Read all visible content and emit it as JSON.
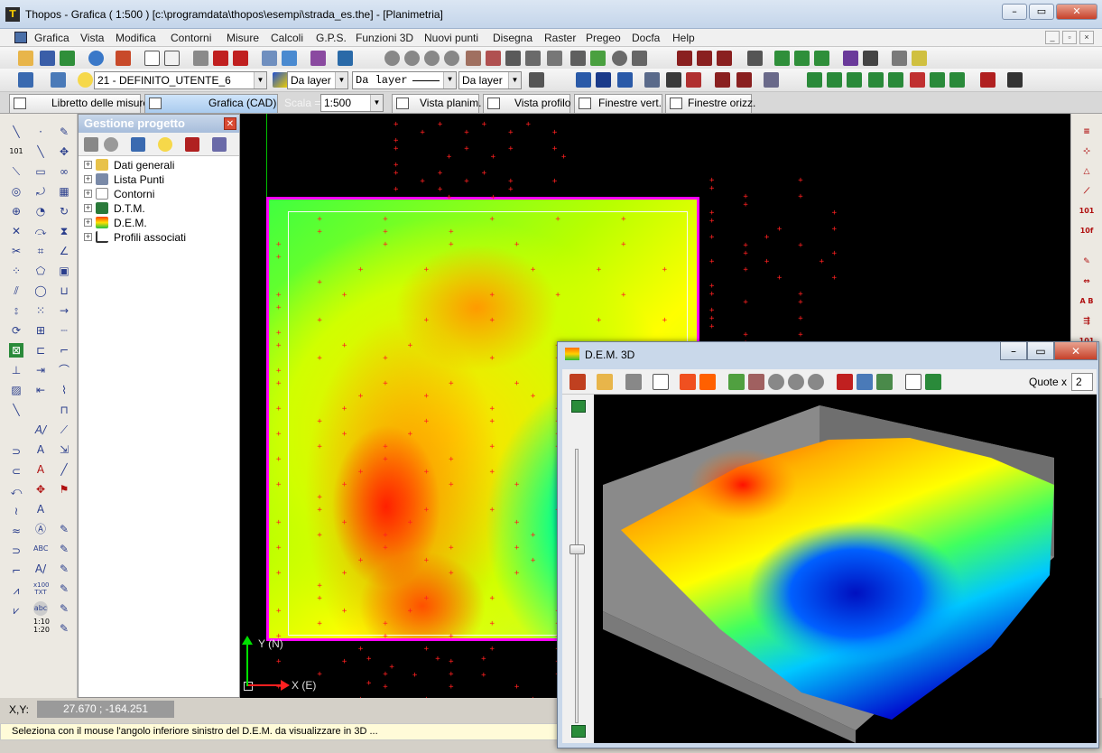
{
  "window": {
    "title": "Thopos - Grafica ( 1:500 ) [c:\\programdata\\thopos\\esempi\\strada_es.the] - [Planimetria]",
    "app_icon": "thopos-logo-icon",
    "minimize": "–",
    "maximize": "▭",
    "close": "✕"
  },
  "menu": {
    "items": [
      "Grafica",
      "Vista",
      "Modifica",
      "Contorni",
      "Misure",
      "Calcoli",
      "G.P.S.",
      "Funzioni 3D",
      "Nuovi punti",
      "Disegna",
      "Raster",
      "Pregeo",
      "Docfa",
      "Help"
    ],
    "mdi_minimize": "_",
    "mdi_restore": "▫",
    "mdi_close": "×"
  },
  "toolbar2": {
    "layer_select": "21 - DEFINITO_UTENTE_6",
    "color_select": "Da layer",
    "linetype_select": "Da layer",
    "lineweight_select": "Da layer"
  },
  "tabs": {
    "libretto": "Libretto delle misure",
    "grafica": "Grafica (CAD)",
    "scala_label": "Scala =",
    "scala_value": "1:500",
    "vista_planim": "Vista planim.",
    "vista_profilo": "Vista profilo",
    "finestre_vert": "Finestre vert.",
    "finestre_orizz": "Finestre orizz."
  },
  "panel": {
    "title": "Gestione progetto",
    "close": "✕",
    "tree": [
      {
        "label": "Dati generali",
        "icon": "folder-icon"
      },
      {
        "label": "Lista Punti",
        "icon": "point-list-icon"
      },
      {
        "label": "Contorni",
        "icon": "contour-icon"
      },
      {
        "label": "D.T.M.",
        "icon": "dtm-icon"
      },
      {
        "label": "D.E.M.",
        "icon": "dem-icon"
      },
      {
        "label": "Profili associati",
        "icon": "profile-icon"
      }
    ]
  },
  "canvas": {
    "axis_x_label": "X (E)",
    "axis_y_label": "Y (N)"
  },
  "coords": {
    "label": "X,Y:",
    "value": "27.670 ; -164.251"
  },
  "status": {
    "text": "Seleziona con il mouse l'angolo inferiore sinistro del D.E.M. da visualizzare in 3D ..."
  },
  "dem3d": {
    "title": "D.E.M. 3D",
    "quote_label": "Quote x",
    "quote_value": "2",
    "minimize": "–",
    "maximize": "▭",
    "close": "✕"
  },
  "colors": {
    "canvas_bg": "#000000",
    "dem_border": "#ff00ff",
    "point_marker": "#ff2020",
    "axis_x": "#ff2020",
    "axis_y": "#00e000"
  }
}
